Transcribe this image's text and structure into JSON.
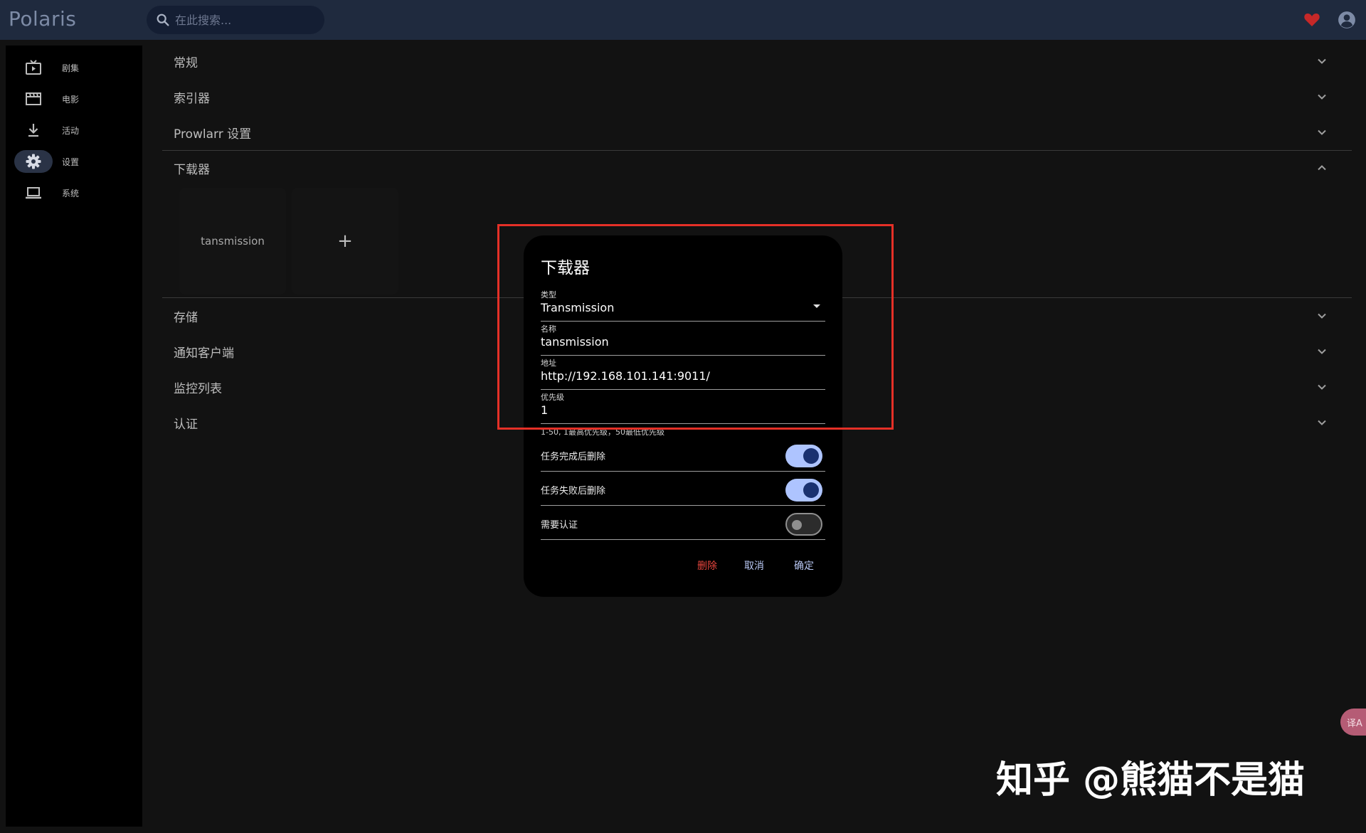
{
  "app": {
    "title": "Polaris"
  },
  "search": {
    "placeholder": "在此搜索..."
  },
  "sidebar": {
    "items": [
      {
        "label": "剧集"
      },
      {
        "label": "电影"
      },
      {
        "label": "活动"
      },
      {
        "label": "设置"
      },
      {
        "label": "系统"
      }
    ],
    "active": "设置"
  },
  "settings": {
    "sections": [
      {
        "title": "常规"
      },
      {
        "title": "索引器"
      },
      {
        "title": "Prowlarr 设置"
      },
      {
        "title": "下载器"
      },
      {
        "title": "存储"
      },
      {
        "title": "通知客户端"
      },
      {
        "title": "监控列表"
      },
      {
        "title": "认证"
      }
    ],
    "expanded": "下载器",
    "downloaders": [
      {
        "name": "tansmission"
      }
    ],
    "add_label": "+"
  },
  "dialog": {
    "title": "下载器",
    "fields": {
      "type": {
        "label": "类型",
        "value": "Transmission"
      },
      "name": {
        "label": "名称",
        "value": "tansmission"
      },
      "address": {
        "label": "地址",
        "value": "http://192.168.101.141:9011/"
      },
      "priority": {
        "label": "优先级",
        "value": "1",
        "helper": "1-50, 1最高优先级，50最低优先级"
      }
    },
    "toggles": [
      {
        "label": "任务完成后删除",
        "on": true
      },
      {
        "label": "任务失败后删除",
        "on": true
      },
      {
        "label": "需要认证",
        "on": false
      }
    ],
    "buttons": {
      "delete": "删除",
      "cancel": "取消",
      "ok": "确定"
    }
  },
  "translate_widget": {
    "label": "译A"
  },
  "watermark": "知乎 @熊猫不是猫",
  "colors": {
    "topbar": "#1f2a3e",
    "background": "#121212",
    "accent": "#aec4ff",
    "danger": "#e8463e",
    "highlight": "#e53027",
    "heart": "#c62828"
  }
}
